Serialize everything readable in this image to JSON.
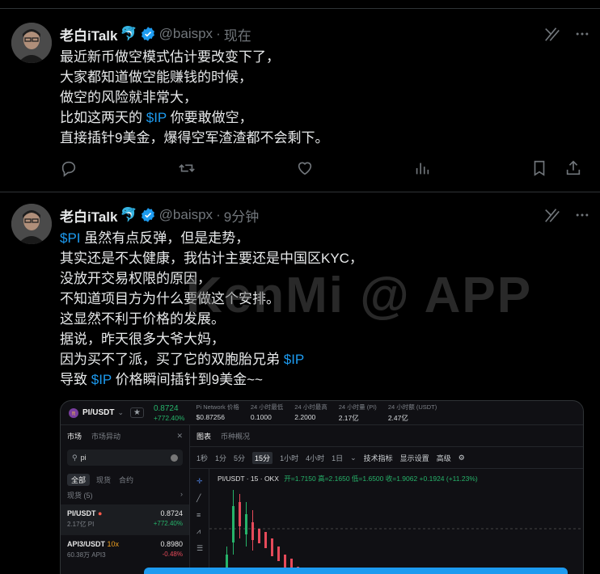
{
  "tweets": [
    {
      "author_name": "老白iTalk",
      "author_emoji": "🐬",
      "handle": "@baispx",
      "time": "现在",
      "text_lines": [
        [
          {
            "t": "最近新币做空模式估计要改变下了，"
          }
        ],
        [
          {
            "t": "大家都知道做空能赚钱的时候，"
          }
        ],
        [
          {
            "t": "做空的风险就非常大，"
          }
        ],
        [
          {
            "t": "比如这两天的 "
          },
          {
            "t": "$IP",
            "cash": true
          },
          {
            "t": " 你要敢做空，"
          }
        ],
        [
          {
            "t": "直接插针9美金，爆得空军渣渣都不会剩下。"
          }
        ]
      ]
    },
    {
      "author_name": "老白iTalk",
      "author_emoji": "🐬",
      "handle": "@baispx",
      "time": "9分钟",
      "text_lines": [
        [
          {
            "t": "$PI",
            "cash": true
          },
          {
            "t": " 虽然有点反弹，但是走势，"
          }
        ],
        [
          {
            "t": "其实还是不太健康，我估计主要还是中国区KYC，"
          }
        ],
        [
          {
            "t": "没放开交易权限的原因，"
          }
        ],
        [
          {
            "t": "不知道项目方为什么要做这个安排。"
          }
        ],
        [
          {
            "t": "这显然不利于价格的发展。"
          }
        ],
        [
          {
            "t": "据说，昨天很多大爷大妈，"
          }
        ],
        [
          {
            "t": "因为买不了派，买了它的双胞胎兄弟 "
          },
          {
            "t": "$IP",
            "cash": true
          }
        ],
        [
          {
            "t": "导致 "
          },
          {
            "t": "$IP",
            "cash": true
          },
          {
            "t": " 价格瞬间插针到9美金~~"
          }
        ]
      ]
    }
  ],
  "watermark": "KenMi @ APP",
  "media": {
    "pair": "PI/USDT",
    "price": "0.8724",
    "change": "+772.40%",
    "stats": [
      {
        "label": "Pi Network 价格",
        "value": "$0.87256"
      },
      {
        "label": "24 小时最低",
        "value": "0.1000"
      },
      {
        "label": "24 小时最高",
        "value": "2.2000"
      },
      {
        "label": "24 小时量 (PI)",
        "value": "2.17亿"
      },
      {
        "label": "24 小时额 (USDT)",
        "value": "2.47亿"
      }
    ],
    "left_tabs": [
      "市场",
      "市场异动"
    ],
    "search_value": "pi",
    "filter_tabs": [
      "全部",
      "现货",
      "合约"
    ],
    "spot_count": "现货 (5)",
    "rows": [
      {
        "pair": "PI/USDT",
        "sub": "2.17亿 PI",
        "price": "0.8724",
        "chg": "+772.40%",
        "up": true
      },
      {
        "pair": "API3/USDT",
        "tag": "10x",
        "sub": "60.38万 API3",
        "price": "0.8980",
        "chg": "-0.48%",
        "up": false
      }
    ],
    "right_tabs": [
      "图表",
      "币种概况"
    ],
    "intervals": [
      "1秒",
      "1分",
      "5分",
      "15分",
      "1小时",
      "4小时",
      "1日"
    ],
    "tools": [
      "技术指标",
      "显示设置",
      "高级"
    ],
    "ohlc_title": "PI/USDT · 15 · OKX",
    "ohlc": "开=1.7150 高=2.1650 低=1.6500 收=1.9062 +0.1924 (+11.23%)"
  }
}
